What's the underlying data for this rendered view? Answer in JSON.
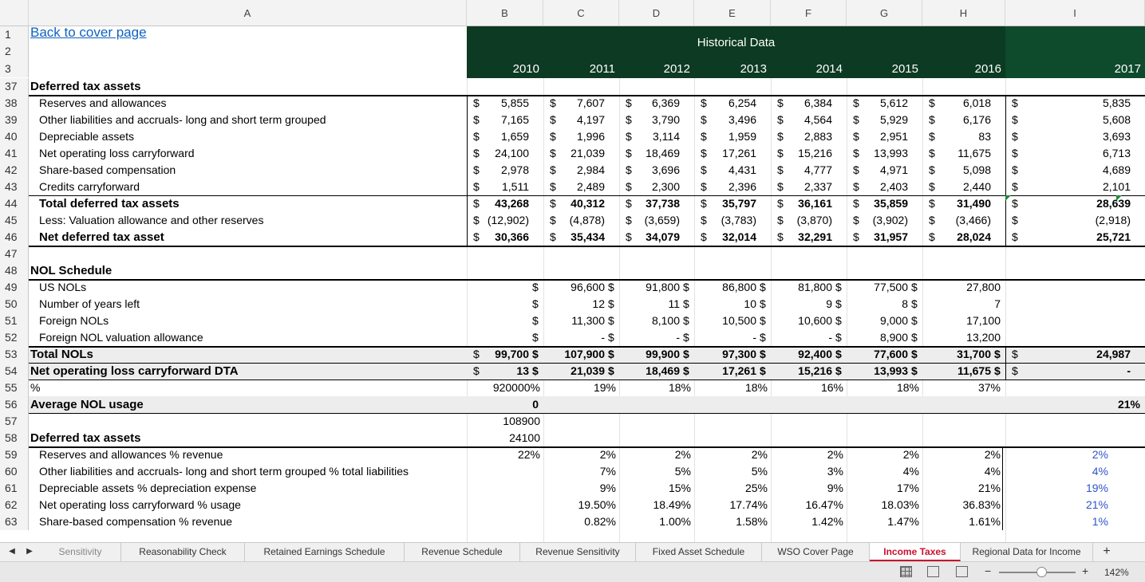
{
  "columns": [
    "A",
    "B",
    "C",
    "D",
    "E",
    "F",
    "G",
    "H",
    "I"
  ],
  "header": {
    "link_text": "Back to cover page",
    "historical_label": "Historical Data",
    "years": [
      "2010",
      "2011",
      "2012",
      "2013",
      "2014",
      "2015",
      "2016",
      "2017"
    ],
    "row_numbers_top": [
      "1",
      "2",
      "3"
    ]
  },
  "currency_symbol": "$",
  "section1": {
    "title_row": "37",
    "title": "Deferred tax assets",
    "rows": [
      {
        "num": "38",
        "label": "Reserves and allowances",
        "values": [
          "5,855",
          "7,607",
          "6,369",
          "6,254",
          "6,384",
          "5,612",
          "6,018",
          "5,835"
        ],
        "bold": false
      },
      {
        "num": "39",
        "label": "Other liabilities and accruals- long and short term grouped",
        "values": [
          "7,165",
          "4,197",
          "3,790",
          "3,496",
          "4,564",
          "5,929",
          "6,176",
          "5,608"
        ],
        "bold": false
      },
      {
        "num": "40",
        "label": "Depreciable assets",
        "values": [
          "1,659",
          "1,996",
          "3,114",
          "1,959",
          "2,883",
          "2,951",
          "83",
          "3,693"
        ],
        "bold": false
      },
      {
        "num": "41",
        "label": "Net operating loss carryforward",
        "values": [
          "24,100",
          "21,039",
          "18,469",
          "17,261",
          "15,216",
          "13,993",
          "11,675",
          "6,713"
        ],
        "bold": false
      },
      {
        "num": "42",
        "label": "Share-based compensation",
        "values": [
          "2,978",
          "2,984",
          "3,696",
          "4,431",
          "4,777",
          "4,971",
          "5,098",
          "4,689"
        ],
        "bold": false
      },
      {
        "num": "43",
        "label": "Credits carryforward",
        "values": [
          "1,511",
          "2,489",
          "2,300",
          "2,396",
          "2,337",
          "2,403",
          "2,440",
          "2,101"
        ],
        "bold": false
      },
      {
        "num": "44",
        "label": "Total deferred tax assets",
        "values": [
          "43,268",
          "40,312",
          "37,738",
          "35,797",
          "36,161",
          "35,859",
          "31,490",
          "28,639"
        ],
        "bold": true
      },
      {
        "num": "45",
        "label": "Less: Valuation allowance and other reserves",
        "values": [
          "(12,902)",
          "(4,878)",
          "(3,659)",
          "(3,783)",
          "(3,870)",
          "(3,902)",
          "(3,466)",
          "(2,918)"
        ],
        "bold": false
      },
      {
        "num": "46",
        "label": "Net deferred tax asset",
        "values": [
          "30,366",
          "35,434",
          "34,079",
          "32,014",
          "32,291",
          "31,957",
          "28,024",
          "25,721"
        ],
        "bold": true
      }
    ]
  },
  "blank_row": "47",
  "nol": {
    "title_row": "48",
    "title": "NOL Schedule",
    "rows": [
      {
        "num": "49",
        "label": "US NOLs",
        "values": [
          "",
          "96,600",
          "91,800",
          "86,800",
          "81,800",
          "77,500",
          "27,800",
          ""
        ]
      },
      {
        "num": "50",
        "label": "Number of years left",
        "values": [
          "",
          "12",
          "11",
          "10",
          "9",
          "8",
          "7",
          ""
        ]
      },
      {
        "num": "51",
        "label": "Foreign NOLs",
        "values": [
          "",
          "11,300",
          "8,100",
          "10,500",
          "10,600",
          "9,000",
          "17,100",
          ""
        ]
      },
      {
        "num": "52",
        "label": "Foreign NOL valuation allowance",
        "values": [
          "",
          "-",
          "-",
          "-",
          "-",
          "8,900",
          "13,200",
          ""
        ]
      }
    ],
    "total": {
      "num": "53",
      "label": "Total NOLs",
      "values": [
        "99,700",
        "107,900",
        "99,900",
        "97,300",
        "92,400",
        "77,600",
        "31,700",
        "24,987"
      ]
    },
    "dta": {
      "num": "54",
      "label": "Net operating loss carryforward DTA",
      "values": [
        "13",
        "21,039",
        "18,469",
        "17,261",
        "15,216",
        "13,993",
        "11,675",
        "-"
      ]
    },
    "pct": {
      "num": "55",
      "label": "%",
      "values": [
        "920000%",
        "19%",
        "18%",
        "18%",
        "16%",
        "18%",
        "37%",
        ""
      ]
    },
    "avg": {
      "num": "56",
      "label": "Average NOL usage",
      "values": [
        "0",
        "",
        "",
        "",
        "",
        "",
        "",
        "21%"
      ]
    },
    "row57": {
      "num": "57",
      "b": "108900"
    },
    "row58b": "24100"
  },
  "section2": {
    "title_row": "58",
    "title": "Deferred tax assets",
    "rows": [
      {
        "num": "59",
        "label": "Reserves and allowances % revenue",
        "values": [
          "22%",
          "2%",
          "2%",
          "2%",
          "2%",
          "2%",
          "2%",
          "2%"
        ]
      },
      {
        "num": "60",
        "label": "Other liabilities and accruals- long and short term grouped % total liabilities",
        "values": [
          "",
          "7%",
          "5%",
          "5%",
          "3%",
          "4%",
          "4%",
          "4%"
        ]
      },
      {
        "num": "61",
        "label": "Depreciable assets % depreciation expense",
        "values": [
          "",
          "9%",
          "15%",
          "25%",
          "9%",
          "17%",
          "21%",
          "19%"
        ]
      },
      {
        "num": "62",
        "label": "Net operating loss carryforward % usage",
        "values": [
          "",
          "19.50%",
          "18.49%",
          "17.74%",
          "16.47%",
          "18.03%",
          "36.83%",
          "21%"
        ]
      },
      {
        "num": "63",
        "label": "Share-based compensation % revenue",
        "values": [
          "",
          "0.82%",
          "1.00%",
          "1.58%",
          "1.42%",
          "1.47%",
          "1.61%",
          "1%"
        ]
      }
    ]
  },
  "tabs": [
    "Sensitivity",
    "Reasonability Check",
    "Retained Earnings Schedule",
    "Revenue Schedule",
    "Revenue Sensitivity",
    "Fixed Asset Schedule",
    "WSO Cover Page",
    "Income Taxes",
    "Regional Data for Income"
  ],
  "active_tab": "Income Taxes",
  "add_sheet": "+",
  "zoom": {
    "minus": "−",
    "plus": "+",
    "level": "142%",
    "fraction": 0.55
  },
  "colors": {
    "header_green": "#0c3a22",
    "header_green_2017": "#0e4a2c",
    "accent": "#c8102e",
    "link": "#0f62c0",
    "blue_values": "#2e56c8"
  }
}
